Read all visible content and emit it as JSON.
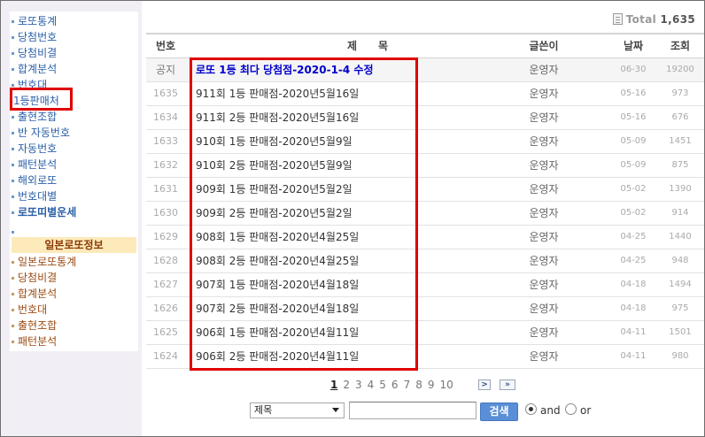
{
  "sidebar": {
    "items": [
      {
        "label": "로또통계"
      },
      {
        "label": "당첨번호"
      },
      {
        "label": "당첨비결"
      },
      {
        "label": "합계분석"
      },
      {
        "label": "번호대"
      },
      {
        "label": "1등판매처"
      },
      {
        "label": "출현조합"
      },
      {
        "label": "반 자동번호"
      },
      {
        "label": "자동번호"
      },
      {
        "label": "패턴분석"
      },
      {
        "label": "해외로또"
      },
      {
        "label": "번호대별"
      },
      {
        "label": "로또띠별운세"
      }
    ],
    "section_title": "일본로또정보",
    "japan_items": [
      {
        "label": "일본로또통계"
      },
      {
        "label": "당첨비결"
      },
      {
        "label": "합계분석"
      },
      {
        "label": "번호대"
      },
      {
        "label": "출현조합"
      },
      {
        "label": "패턴분석"
      }
    ]
  },
  "board": {
    "total_label": "Total",
    "total_count": "1,635",
    "headers": {
      "num": "번호",
      "subject": "제　　목",
      "writer": "글쓴이",
      "date": "날짜",
      "hits": "조회"
    },
    "rows": [
      {
        "num": "공지",
        "subject": "로또 1등 최다 당첨점-2020-1-4 수정",
        "writer": "운영자",
        "date": "06-30",
        "hits": "19200"
      },
      {
        "num": "1635",
        "subject": "911회 1등 판매점-2020년5월16일",
        "writer": "운영자",
        "date": "05-16",
        "hits": "973"
      },
      {
        "num": "1634",
        "subject": "911회 2등 판매점-2020년5월16일",
        "writer": "운영자",
        "date": "05-16",
        "hits": "676"
      },
      {
        "num": "1633",
        "subject": "910회 1등 판매점-2020년5월9일",
        "writer": "운영자",
        "date": "05-09",
        "hits": "1451"
      },
      {
        "num": "1632",
        "subject": "910회 2등 판매점-2020년5월9일",
        "writer": "운영자",
        "date": "05-09",
        "hits": "875"
      },
      {
        "num": "1631",
        "subject": "909회 1등 판매점-2020년5월2일",
        "writer": "운영자",
        "date": "05-02",
        "hits": "1390"
      },
      {
        "num": "1630",
        "subject": "909회 2등 판매점-2020년5월2일",
        "writer": "운영자",
        "date": "05-02",
        "hits": "914"
      },
      {
        "num": "1629",
        "subject": "908회 1등 판매점-2020년4월25일",
        "writer": "운영자",
        "date": "04-25",
        "hits": "1440"
      },
      {
        "num": "1628",
        "subject": "908회 2등 판매점-2020년4월25일",
        "writer": "운영자",
        "date": "04-25",
        "hits": "948"
      },
      {
        "num": "1627",
        "subject": "907회 1등 판매점-2020년4월18일",
        "writer": "운영자",
        "date": "04-18",
        "hits": "1494"
      },
      {
        "num": "1626",
        "subject": "907회 2등 판매점-2020년4월18일",
        "writer": "운영자",
        "date": "04-18",
        "hits": "975"
      },
      {
        "num": "1625",
        "subject": "906회 1등 판매점-2020년4월11일",
        "writer": "운영자",
        "date": "04-11",
        "hits": "1501"
      },
      {
        "num": "1624",
        "subject": "906회 2등 판매점-2020년4월11일",
        "writer": "운영자",
        "date": "04-11",
        "hits": "980"
      }
    ]
  },
  "pagination": {
    "pages": [
      "1",
      "2",
      "3",
      "4",
      "5",
      "6",
      "7",
      "8",
      "9",
      "10"
    ],
    "current": "1",
    "next_label": ">",
    "last_label": "»"
  },
  "search": {
    "field_value": "제목",
    "query_value": "",
    "button_label": "검색",
    "and_label": "and",
    "or_label": "or"
  },
  "colors": {
    "highlight": "#e00000",
    "link": "#2a5fa8",
    "notice": "#0000cc",
    "search_button": "#5a8ed6"
  }
}
